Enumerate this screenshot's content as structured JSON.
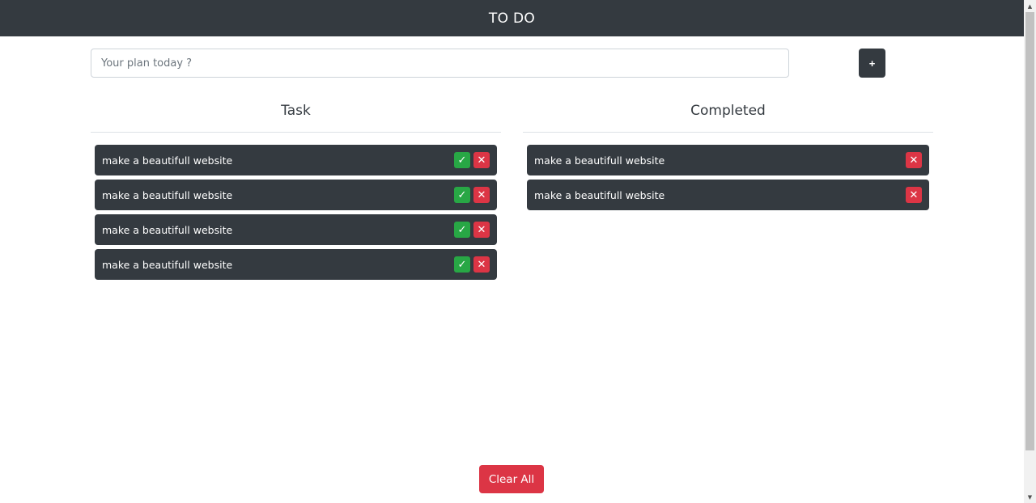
{
  "header": {
    "title": "TO DO"
  },
  "input": {
    "placeholder": "Your plan today ?",
    "value": ""
  },
  "add_button": {
    "label": "+"
  },
  "columns": {
    "task": {
      "heading": "Task",
      "items": [
        {
          "text": "make a beautifull website"
        },
        {
          "text": "make a beautifull website"
        },
        {
          "text": "make a beautifull website"
        },
        {
          "text": "make a beautifull website"
        }
      ]
    },
    "completed": {
      "heading": "Completed",
      "items": [
        {
          "text": "make a beautifull website"
        },
        {
          "text": "make a beautifull website"
        }
      ]
    }
  },
  "icons": {
    "complete": "✓",
    "delete": "✕",
    "complete_name": "check-icon",
    "delete_name": "close-icon"
  },
  "clear_button": {
    "label": "Clear All"
  },
  "colors": {
    "navbar": "#343a40",
    "item_bg": "#343a40",
    "success": "#28a745",
    "danger": "#dc3545"
  }
}
